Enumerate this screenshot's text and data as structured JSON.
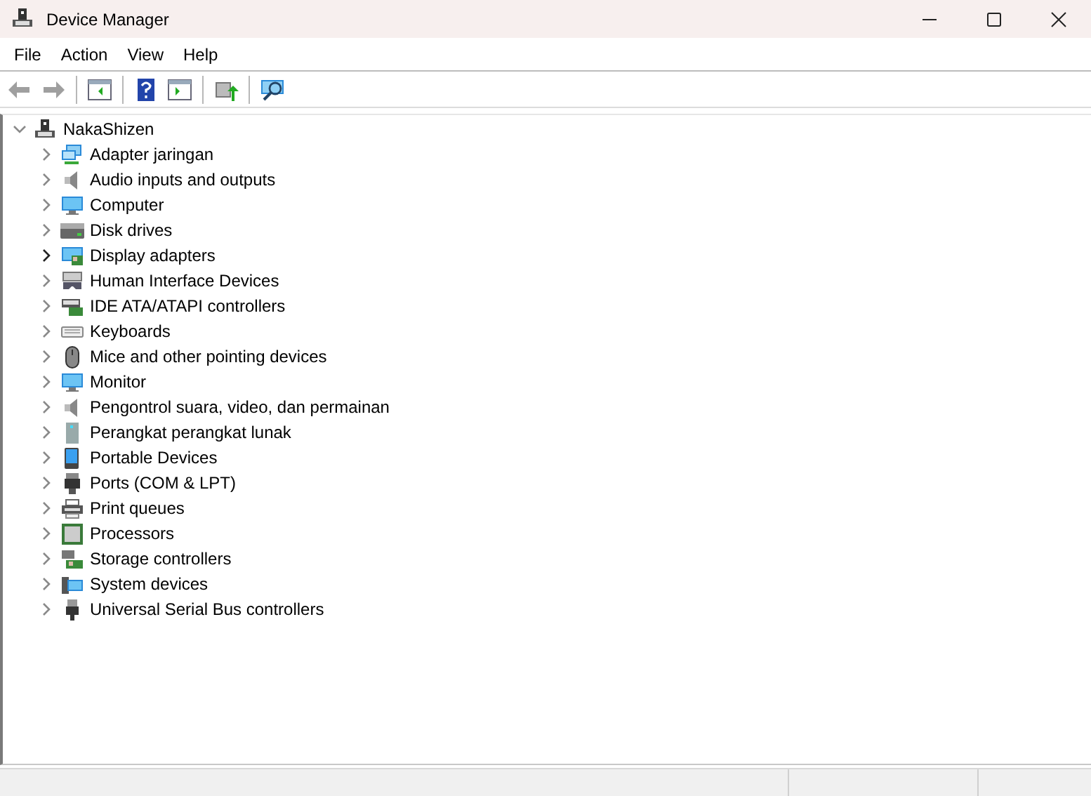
{
  "window": {
    "title": "Device Manager"
  },
  "menu": [
    "File",
    "Action",
    "View",
    "Help"
  ],
  "toolbar": [
    {
      "kind": "back",
      "disabled": true
    },
    {
      "kind": "forward",
      "disabled": true
    },
    {
      "kind": "sep"
    },
    {
      "kind": "console-tree"
    },
    {
      "kind": "sep"
    },
    {
      "kind": "help"
    },
    {
      "kind": "action-pane"
    },
    {
      "kind": "sep"
    },
    {
      "kind": "update-driver"
    },
    {
      "kind": "sep"
    },
    {
      "kind": "scan"
    }
  ],
  "tree": {
    "label": "NakaShizen",
    "expanded": true,
    "kind": "computer-tower",
    "children": [
      {
        "label": "Adapter jaringan",
        "kind": "network",
        "expanded": false,
        "hovered": false
      },
      {
        "label": "Audio inputs and outputs",
        "kind": "speaker",
        "expanded": false,
        "hovered": false
      },
      {
        "label": "Computer",
        "kind": "monitor",
        "expanded": false,
        "hovered": false
      },
      {
        "label": "Disk drives",
        "kind": "disk",
        "expanded": false,
        "hovered": false
      },
      {
        "label": "Display adapters",
        "kind": "display-adapter",
        "expanded": false,
        "hovered": true
      },
      {
        "label": "Human Interface Devices",
        "kind": "hid",
        "expanded": false,
        "hovered": false
      },
      {
        "label": "IDE ATA/ATAPI controllers",
        "kind": "ide",
        "expanded": false,
        "hovered": false
      },
      {
        "label": "Keyboards",
        "kind": "keyboard",
        "expanded": false,
        "hovered": false
      },
      {
        "label": "Mice and other pointing devices",
        "kind": "mouse",
        "expanded": false,
        "hovered": false
      },
      {
        "label": "Monitor",
        "kind": "monitor",
        "expanded": false,
        "hovered": false
      },
      {
        "label": "Pengontrol suara, video, dan permainan",
        "kind": "speaker",
        "expanded": false,
        "hovered": false
      },
      {
        "label": "Perangkat perangkat lunak",
        "kind": "tower",
        "expanded": false,
        "hovered": false
      },
      {
        "label": "Portable Devices",
        "kind": "phone",
        "expanded": false,
        "hovered": false
      },
      {
        "label": "Ports (COM & LPT)",
        "kind": "port",
        "expanded": false,
        "hovered": false
      },
      {
        "label": "Print queues",
        "kind": "printer",
        "expanded": false,
        "hovered": false
      },
      {
        "label": "Processors",
        "kind": "chip",
        "expanded": false,
        "hovered": false
      },
      {
        "label": "Storage controllers",
        "kind": "storage",
        "expanded": false,
        "hovered": false
      },
      {
        "label": "System devices",
        "kind": "system",
        "expanded": false,
        "hovered": false
      },
      {
        "label": "Universal Serial Bus controllers",
        "kind": "usb",
        "expanded": false,
        "hovered": false
      }
    ]
  }
}
